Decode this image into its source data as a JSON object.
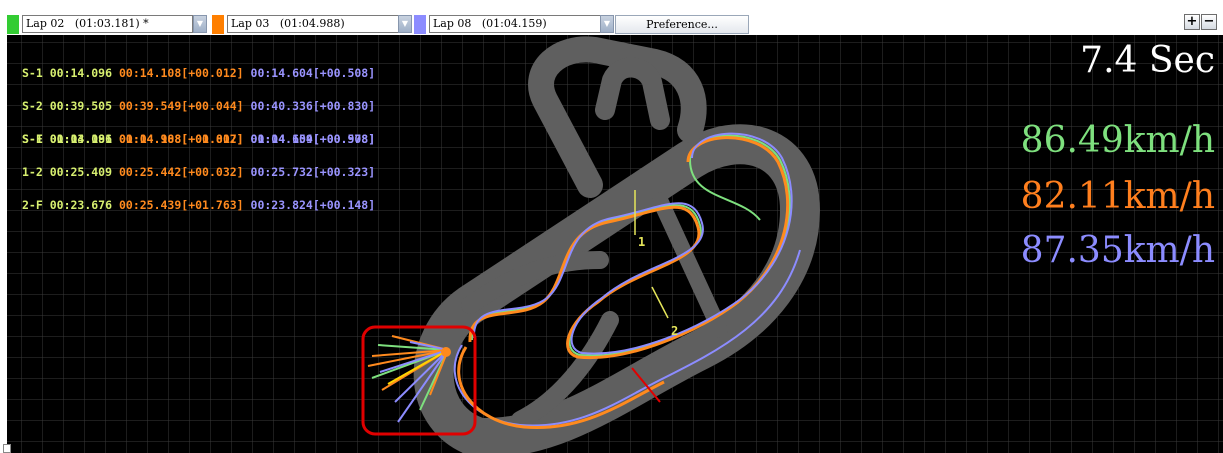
{
  "toolbar": {
    "laps": [
      {
        "label": "Lap 02   (01:03.181) *",
        "color": "#33cc33"
      },
      {
        "label": "Lap 03   (01:04.988)",
        "color": "#ff7f00"
      },
      {
        "label": "Lap 08   (01:04.159)",
        "color": "#8c8cff"
      }
    ],
    "preference_label": "Preference...",
    "zoom_in": "+",
    "zoom_out": "−"
  },
  "splits_a": [
    {
      "name": "S-1",
      "l1": "00:14.096",
      "l2": "00:14.108[+00.012]",
      "l3": "00:14.604[+00.508]"
    },
    {
      "name": "S-2",
      "l1": "00:39.505",
      "l2": "00:39.549[+00.044]",
      "l3": "00:40.336[+00.830]"
    },
    {
      "name": "S-F",
      "l1": "01:03.181",
      "l2": "01:04.988[+01.807]",
      "l3": "01:04.159[+00.978]"
    }
  ],
  "splits_b": [
    {
      "name": "S-1",
      "l1": "00:14.096",
      "l2": "00:14.108[+00.012]",
      "l3": "00:14.604[+00.508]"
    },
    {
      "name": "1-2",
      "l1": "00:25.409",
      "l2": "00:25.442[+00.032]",
      "l3": "00:25.732[+00.323]"
    },
    {
      "name": "2-F",
      "l1": "00:23.676",
      "l2": "00:25.439[+01.763]",
      "l3": "00:23.824[+00.148]"
    }
  ],
  "elapsed": "7.4 Sec",
  "speeds": [
    {
      "value": "86.49km/h",
      "color": "#7ee07e"
    },
    {
      "value": "82.11km/h",
      "color": "#ff7f1e"
    },
    {
      "value": "87.35km/h",
      "color": "#8c8cff"
    }
  ],
  "markers": {
    "sector1": "1",
    "sector2": "2"
  },
  "highlight_color": "#e00000"
}
